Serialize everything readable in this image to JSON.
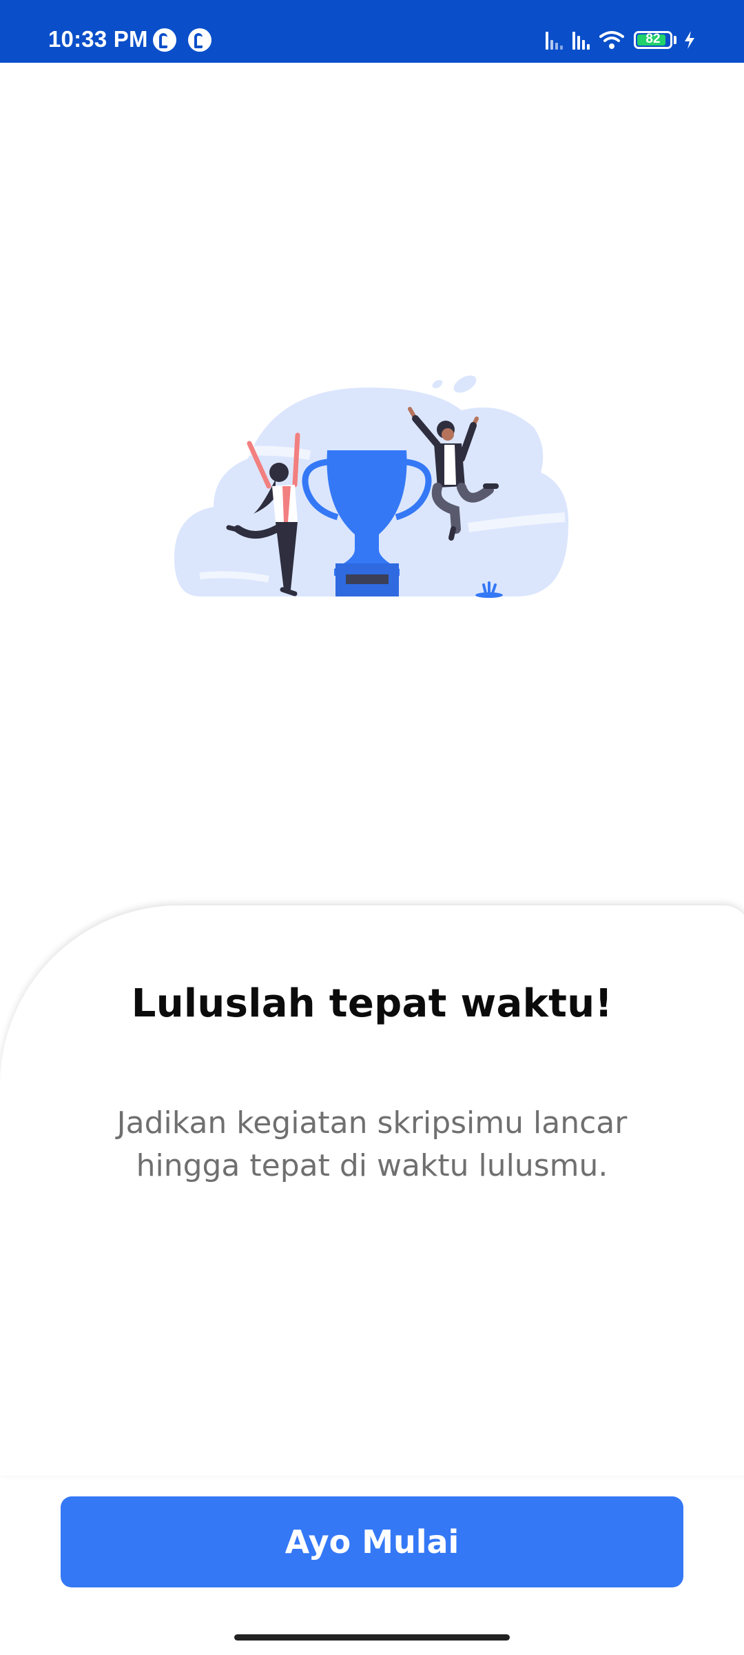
{
  "status_bar": {
    "time": "10:33 PM",
    "battery_level": "82",
    "icons": [
      "app-notification-icon",
      "app-notification-icon",
      "signal-icon",
      "signal-icon",
      "wifi-icon",
      "battery-icon",
      "charging-icon"
    ]
  },
  "illustration": {
    "icon": "trophy-celebration-illustration"
  },
  "onboarding": {
    "title": "Luluslah tepat waktu!",
    "subtitle": "Jadikan kegiatan skripsimu lancar hingga tepat di waktu lulusmu."
  },
  "actions": {
    "start_label": "Ayo Mulai"
  },
  "colors": {
    "status_bar": "#0a4fc9",
    "primary": "#3478f6",
    "cloud": "#dbe6fd"
  }
}
